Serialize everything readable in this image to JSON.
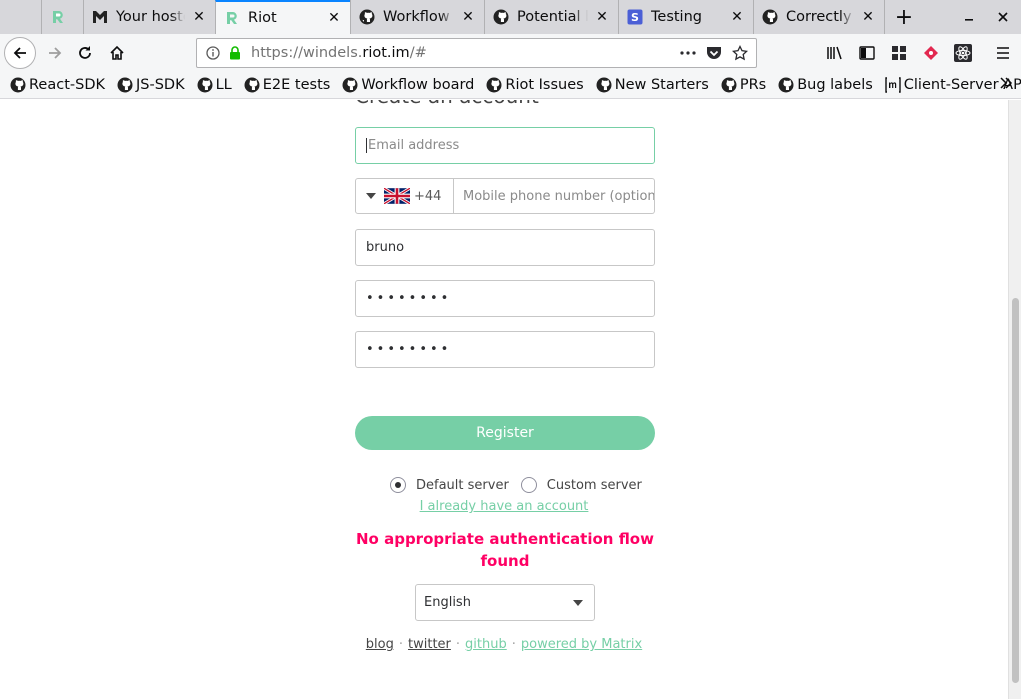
{
  "browser": {
    "tabs": [
      {
        "title": "",
        "icon": "riot-icon",
        "close": false,
        "active": false
      },
      {
        "title": "Your hosted",
        "icon": "gmail-icon",
        "close": true,
        "active": false
      },
      {
        "title": "Riot",
        "icon": "riot-icon",
        "close": true,
        "active": true
      },
      {
        "title": "Workflow",
        "icon": "github-icon",
        "close": true,
        "active": false
      },
      {
        "title": "Potential bl",
        "icon": "github-icon",
        "close": true,
        "active": false
      },
      {
        "title": "Testing",
        "icon": "slides-icon",
        "close": true,
        "active": false
      },
      {
        "title": "Correctly m",
        "icon": "github-icon",
        "close": true,
        "active": false
      }
    ],
    "new_tab_label": "+",
    "url": {
      "prefix": "https://windels.",
      "host": "riot.im",
      "suffix": "/#"
    },
    "bookmarks": [
      {
        "label": "React-SDK",
        "icon": "github-icon"
      },
      {
        "label": "JS-SDK",
        "icon": "github-icon"
      },
      {
        "label": "LL",
        "icon": "github-icon"
      },
      {
        "label": "E2E tests",
        "icon": "github-icon"
      },
      {
        "label": "Workflow board",
        "icon": "github-icon"
      },
      {
        "label": "Riot Issues",
        "icon": "github-icon"
      },
      {
        "label": "New Starters",
        "icon": "github-icon"
      },
      {
        "label": "PRs",
        "icon": "github-icon"
      },
      {
        "label": "Bug labels",
        "icon": "github-icon"
      },
      {
        "label": "Client-Server API",
        "icon": "matrix-icon"
      }
    ]
  },
  "form": {
    "heading": "Create an account",
    "email_placeholder": "Email address",
    "country_code": "+44",
    "phone_placeholder": "Mobile phone number (optional)",
    "username_value": "bruno",
    "password_value": "••••••••",
    "confirm_value": "••••••••",
    "register_label": "Register",
    "default_server_label": "Default server",
    "custom_server_label": "Custom server",
    "login_link": "I already have an account",
    "error": "No appropriate authentication flow found",
    "language": "English"
  },
  "footer": {
    "blog": "blog",
    "twitter": "twitter",
    "github": "github",
    "matrix": "powered by Matrix",
    "separator": "·"
  },
  "colors": {
    "accent": "#76cfa6",
    "error": "#ff0064",
    "tab_highlight": "#0a84ff"
  }
}
